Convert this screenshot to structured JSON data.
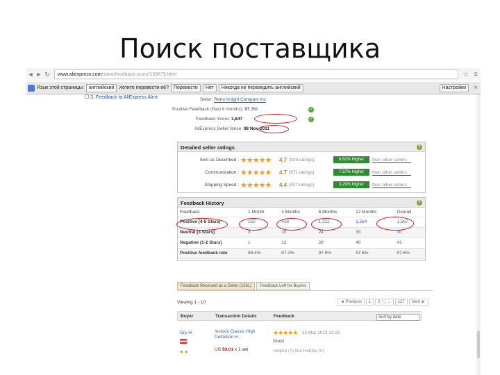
{
  "slide_title": "Поиск поставщика",
  "browser": {
    "url_host": "www.aliexpress.com",
    "url_path": "/store/feedback-score/109475.html",
    "translate_bar": {
      "lang_text": "Язык этой страницы:",
      "lang_value": "английский",
      "question": "Хотите перевести её?",
      "translate_button": "Перевести",
      "no_button": "Нет",
      "never_button": "Никогда не переводить английский",
      "settings_button": "Настройки"
    },
    "left_link": "3. Feedback to AliExpress Alert"
  },
  "seller_info": {
    "seller_label": "Seller:",
    "seller_value": "Retro Knight Compant Inc",
    "positive_label": "Positive Feedback (Past 6 months):",
    "positive_value": "97.3%",
    "score_label": "Feedback Score:",
    "score_value": "1,647",
    "since_label": "AliExpress Seller Since:",
    "since_value": "08 Nov 2011"
  },
  "detailed_ratings": {
    "title": "Detailed seller ratings",
    "rows": [
      {
        "label": "Item as Described :",
        "stars": "★★★★★",
        "score": "4.7",
        "count": "(929 ratings)",
        "higher": "6.82% Higher",
        "than": "than other sellers"
      },
      {
        "label": "Communication :",
        "stars": "★★★★★",
        "score": "4.7",
        "count": "(971 ratings)",
        "higher": "7.37% Higher",
        "than": "than other sellers"
      },
      {
        "label": "Shipping Speed :",
        "stars": "★★★★★",
        "score": "4.4",
        "count": "(927 ratings)",
        "higher": "3.29% Higher",
        "than": "than other sellers"
      }
    ]
  },
  "feedback_history": {
    "title": "Feedback History",
    "headers": [
      "Feedback",
      "1 Month",
      "3 Months",
      "6 Months",
      "12 Months",
      "Overall"
    ],
    "rows": [
      {
        "label": "Positive (4-5 Stars)",
        "values": [
          "150",
          "418",
          "1,211",
          "1,564",
          "1,567"
        ]
      },
      {
        "label": "Neutral (3 Stars)",
        "values": [
          "3",
          "10",
          "24",
          "30",
          "30"
        ]
      },
      {
        "label": "Negative (1-2 Stars)",
        "values": [
          "1",
          "12",
          "28",
          "40",
          "41"
        ]
      },
      {
        "label": "Positive feedback rate",
        "values": [
          "99.4%",
          "97.2%",
          "97.8%",
          "97.6%",
          "97.6%"
        ]
      }
    ]
  },
  "tabs": [
    "Feedback Received as a Seller (1281)",
    "Feedback Left for Buyers"
  ],
  "listing": {
    "viewing": "Viewing 1 - 10",
    "pager": [
      "◄ Previous",
      "1",
      "2",
      "...",
      "127",
      "Next ►"
    ],
    "col_buyer": "Buyer",
    "col_transaction": "Transaction Details",
    "col_feedback": "Feedback",
    "sort_value": "Sort by date",
    "row": {
      "buyer": "Gry H.",
      "transaction": "Instock Classic High Definition H...",
      "price_prefix": "US $",
      "price_value": "9.01",
      "price_suffix": "x 1 set",
      "stars": "★★★★★",
      "date": "22 Mar 2013 13:22",
      "text": "Good",
      "helpful": "Helpful (0)   Not Helpful (0)"
    }
  }
}
